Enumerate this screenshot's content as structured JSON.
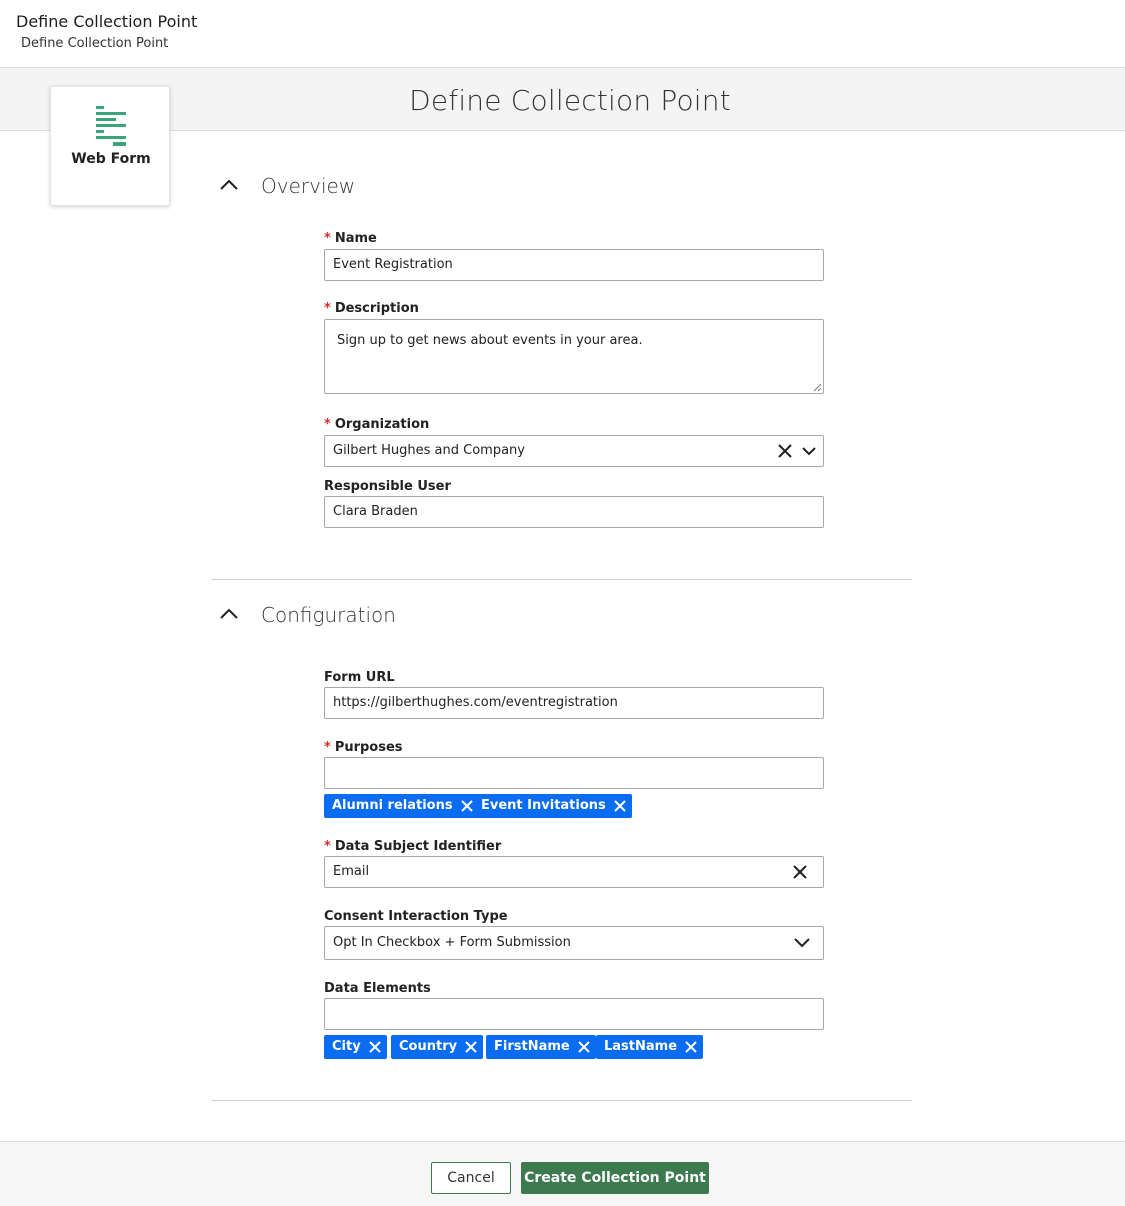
{
  "header": {
    "title": "Define Collection Point",
    "breadcrumb": "Define Collection Point"
  },
  "page_title": "Define Collection Point",
  "type_card": {
    "label": "Web Form",
    "icon": "web-form-icon",
    "icon_color": "#3aa57a"
  },
  "overview": {
    "title": "Overview",
    "name": {
      "label": "Name",
      "required": true,
      "value": "Event Registration"
    },
    "description": {
      "label": "Description",
      "required": true,
      "value": "Sign up to get news about events in your area."
    },
    "organization": {
      "label": "Organization",
      "required": true,
      "value": "Gilbert Hughes and Company"
    },
    "responsible_user": {
      "label": "Responsible User",
      "value": "Clara Braden"
    }
  },
  "configuration": {
    "title": "Configuration",
    "form_url": {
      "label": "Form URL",
      "value": "https://gilberthughes.com/eventregistration"
    },
    "purposes": {
      "label": "Purposes",
      "required": true,
      "value": "",
      "tags": [
        "Alumni relations",
        "Event Invitations"
      ]
    },
    "data_subject_identifier": {
      "label": "Data Subject Identifier",
      "required": true,
      "value": "Email"
    },
    "consent_interaction_type": {
      "label": "Consent Interaction Type",
      "value": "Opt In Checkbox + Form Submission"
    },
    "data_elements": {
      "label": "Data Elements",
      "value": "",
      "tags": [
        "City",
        "Country",
        "FirstName",
        "LastName"
      ]
    }
  },
  "footer": {
    "cancel_label": "Cancel",
    "create_label": "Create Collection Point"
  },
  "colors": {
    "tag_blue": "#0a6cf0",
    "primary_green": "#3d7a4f",
    "required_red": "#d32f2f"
  }
}
